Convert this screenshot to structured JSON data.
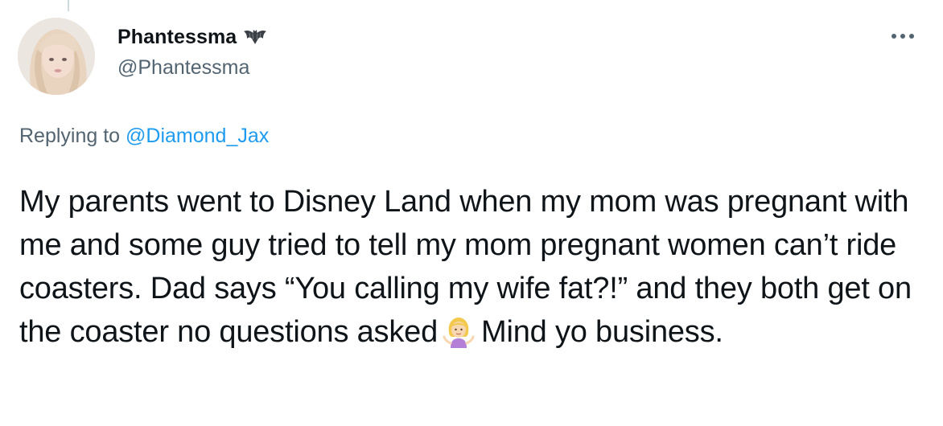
{
  "tweet": {
    "author": {
      "display_name": "Phantessma",
      "handle": "@Phantessma",
      "badge_icon": "bat-icon",
      "avatar_icon": "profile-photo"
    },
    "more_icon": "more-options-icon",
    "reply_context": {
      "prefix": "Replying to ",
      "mention": "@Diamond_Jax"
    },
    "text_part1": "My parents went to Disney Land when my mom was pregnant with me and some guy tried to tell my mom pregnant women can’t ride coasters. Dad says “You calling my wife fat?!” and they both get on the coaster no questions asked",
    "emoji_icon": "woman-shrugging-emoji",
    "text_part2": "Mind yo business."
  },
  "colors": {
    "text_primary": "#0f1419",
    "text_secondary": "#536471",
    "link": "#1d9bf0",
    "thread_line": "#cfd9de"
  }
}
